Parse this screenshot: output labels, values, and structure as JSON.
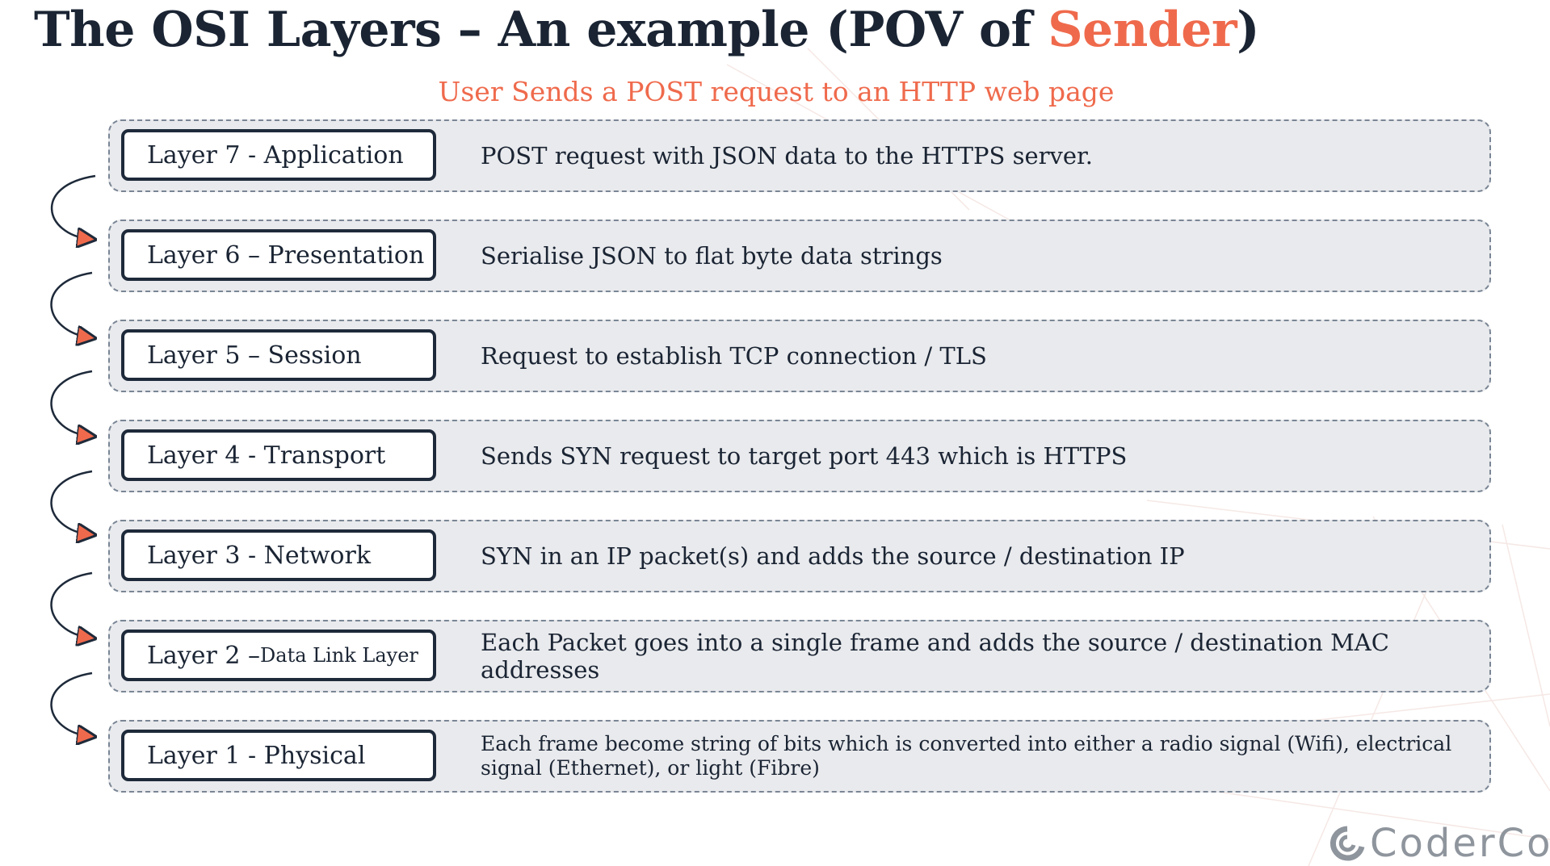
{
  "header": {
    "title_prefix": "The OSI Layers – An example (POV of ",
    "title_accent": "Sender",
    "title_suffix": ")",
    "subtitle": "User Sends a POST request to an HTTP web page"
  },
  "layers": [
    {
      "label": "Layer 7 - Application",
      "label_small": "",
      "description": "POST request with JSON data to the HTTPS server."
    },
    {
      "label": "Layer 6 – Presentation",
      "label_small": "",
      "description": "Serialise JSON to flat byte data strings"
    },
    {
      "label": "Layer 5 – Session",
      "label_small": "",
      "description": "Request to establish TCP connection / TLS"
    },
    {
      "label": "Layer 4 - Transport",
      "label_small": "",
      "description": "Sends SYN request to target port 443 which is HTTPS"
    },
    {
      "label": "Layer 3 - Network",
      "label_small": "",
      "description": "SYN in an IP packet(s) and adds the source / destination IP"
    },
    {
      "label": "Layer 2 – ",
      "label_small": "Data Link Layer",
      "description": "Each Packet goes into a single frame and adds the source / destination MAC addresses"
    },
    {
      "label": "Layer 1 - Physical",
      "label_small": "",
      "description": "Each frame become string of bits which is converted into either a radio signal (Wifi), electrical signal (Ethernet), or light (Fibre)"
    }
  ],
  "logo": {
    "text": "CoderCo."
  },
  "colors": {
    "accent": "#ef6a4c",
    "dark": "#1a2433",
    "row_bg": "#e9eaed"
  }
}
